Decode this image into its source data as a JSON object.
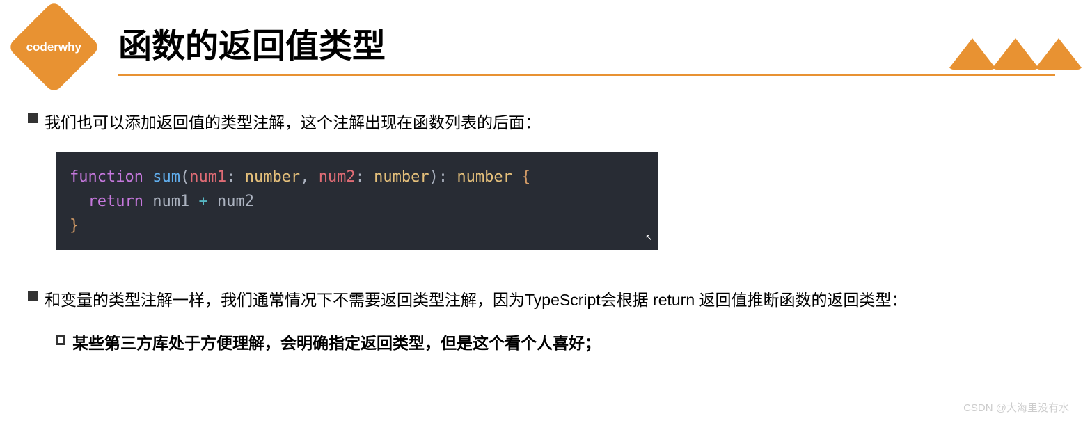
{
  "logo": {
    "text": "coderwhy"
  },
  "title": "函数的返回值类型",
  "bullets": [
    {
      "text": "我们也可以添加返回值的类型注解，这个注解出现在函数列表的后面："
    },
    {
      "text": "和变量的类型注解一样，我们通常情况下不需要返回类型注解，因为TypeScript会根据 return 返回值推断函数的返回类型："
    }
  ],
  "code": {
    "tokens": {
      "function": "function",
      "fnName": "sum",
      "lparen": "(",
      "param1": "num1",
      "colon1": ":",
      "type1": "number",
      "comma": ",",
      "param2": "num2",
      "colon2": ":",
      "type2": "number",
      "rparen": ")",
      "colon3": ":",
      "retType": "number",
      "lbrace": "{",
      "return": "return",
      "ref1": "num1",
      "plus": "+",
      "ref2": "num2",
      "rbrace": "}"
    }
  },
  "subBullet": {
    "text": "某些第三方库处于方便理解，会明确指定返回类型，但是这个看个人喜好；"
  },
  "watermark": "CSDN @大海里没有水"
}
